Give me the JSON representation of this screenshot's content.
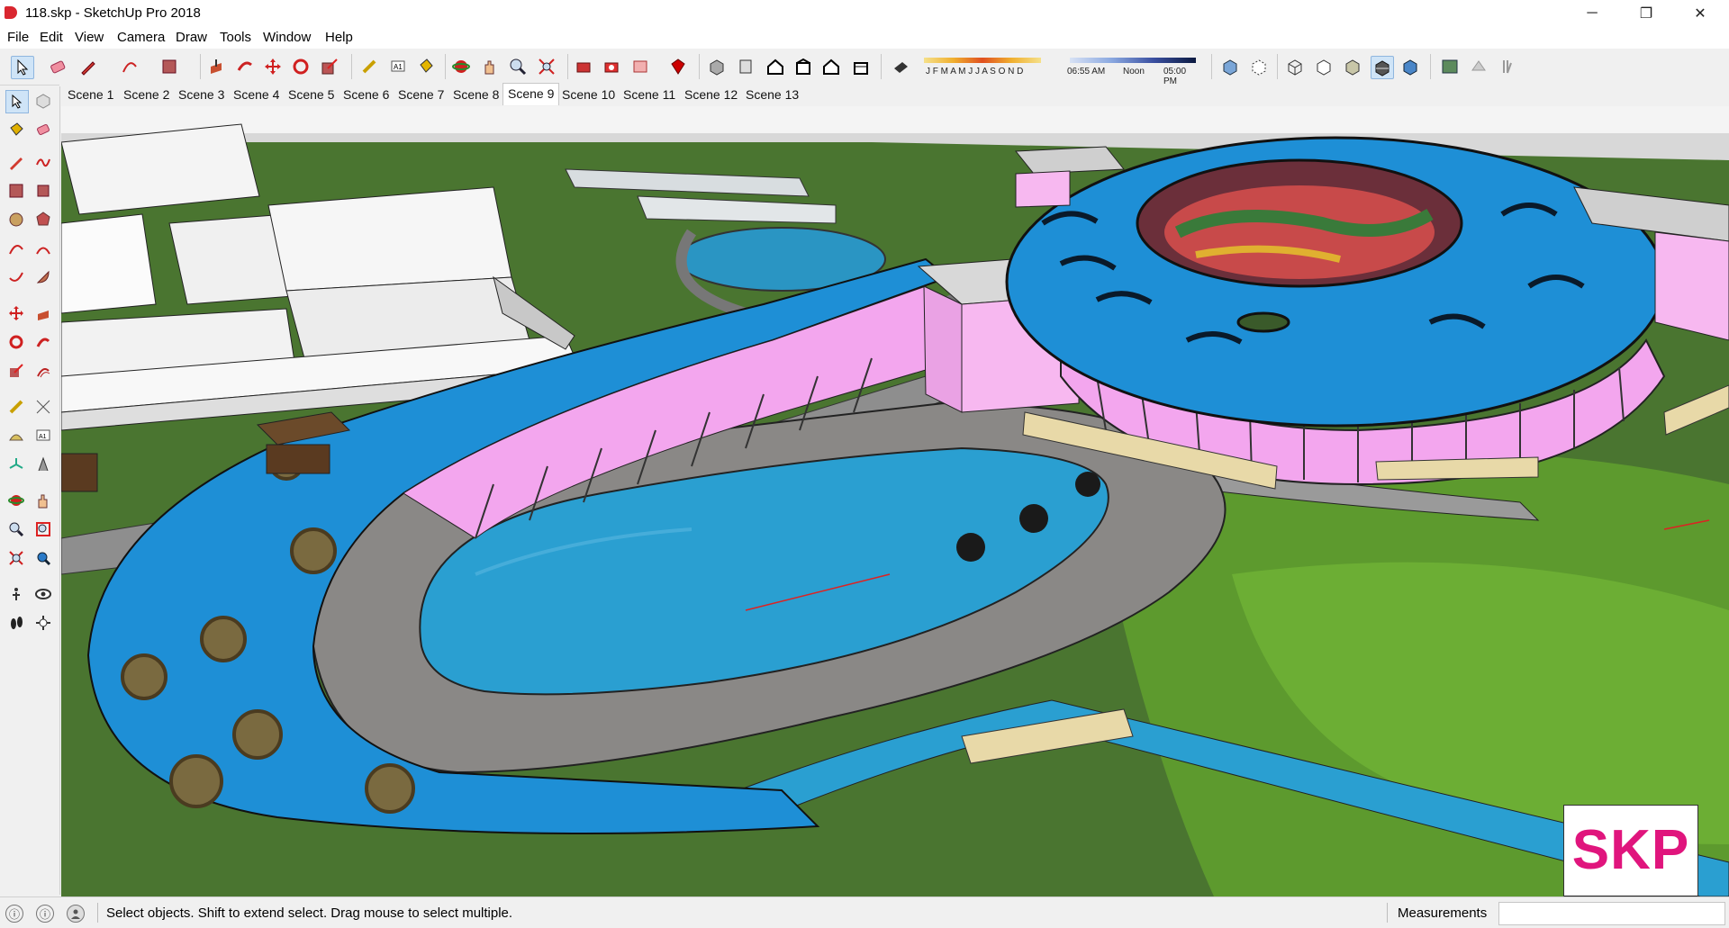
{
  "window": {
    "title": "118.skp - SketchUp Pro 2018",
    "minimize": "─",
    "maximize": "❐",
    "close": "✕"
  },
  "menu": [
    "File",
    "Edit",
    "View",
    "Camera",
    "Draw",
    "Tools",
    "Window",
    "Help"
  ],
  "shadow_settings": {
    "months": "J F M A M J J A S O N D",
    "time_start": "06:55 AM",
    "time_mid": "Noon",
    "time_end": "05:00 PM"
  },
  "scenes": {
    "tabs": [
      "Scene 1",
      "Scene 2",
      "Scene 3",
      "Scene 4",
      "Scene 5",
      "Scene 6",
      "Scene 7",
      "Scene 8",
      "Scene 9",
      "Scene 10",
      "Scene 11",
      "Scene 12",
      "Scene 13"
    ],
    "active": "Scene 9"
  },
  "status": {
    "message": "Select objects. Shift to extend select. Drag mouse to select multiple.",
    "measurements_label": "Measurements",
    "measurements_value": ""
  },
  "watermark": {
    "text": "SKP",
    "color": "#e0157d"
  },
  "colors": {
    "grass": "#4e7a31",
    "water": "#2a9fd1",
    "roof": "#1e8fd6",
    "glass": "#f3a6ee",
    "paving": "#8a8a88",
    "accent_red": "#d9262f"
  },
  "icons": {
    "toolbar": [
      "select-icon",
      "eraser-icon",
      "pencil-icon",
      "arc-icon",
      "rectangle-icon",
      "push-pull-icon",
      "follow-me-icon",
      "move-icon",
      "rotate-icon",
      "scale-icon",
      "tape-measure-icon",
      "text-icon",
      "paint-bucket-icon",
      "orbit-icon",
      "pan-icon",
      "zoom-icon",
      "zoom-extents-icon",
      "warehouse-icon",
      "extension-warehouse-icon",
      "send-to-layout-icon",
      "ruby-icon",
      "iso-view-icon",
      "top-view-icon",
      "front-view-icon",
      "right-view-icon",
      "back-view-icon",
      "left-view-icon",
      "shadow-toggle-icon",
      "xray-icon",
      "back-edges-icon",
      "wireframe-icon",
      "hidden-line-icon",
      "shaded-icon",
      "shaded-textures-icon",
      "monochrome-icon",
      "styles-icon",
      "section-plane-icon",
      "section-fill-icon"
    ],
    "palette": [
      "select-icon",
      "component-icon",
      "paint-bucket-icon",
      "eraser-icon",
      "pencil-icon",
      "freehand-icon",
      "rectangle-icon",
      "rotated-rectangle-icon",
      "circle-icon",
      "polygon-icon",
      "arc-icon",
      "two-point-arc-icon",
      "three-point-arc-icon",
      "pie-icon",
      "move-icon",
      "push-pull-icon",
      "rotate-icon",
      "follow-me-icon",
      "scale-icon",
      "offset-icon",
      "tape-measure-icon",
      "dimension-icon",
      "protractor-icon",
      "text-icon",
      "axes-icon",
      "3d-text-icon",
      "orbit-icon",
      "pan-icon",
      "zoom-icon",
      "zoom-window-icon",
      "zoom-extents-icon",
      "previous-view-icon",
      "position-camera-icon",
      "look-around-icon",
      "walk-icon",
      "section-plane-icon"
    ]
  }
}
